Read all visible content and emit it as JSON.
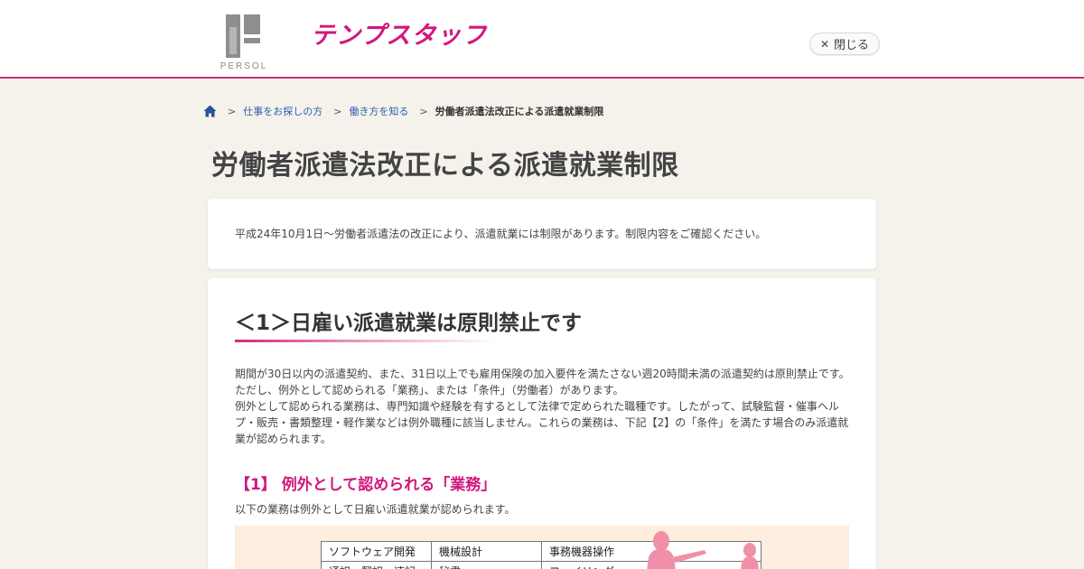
{
  "header": {
    "persol_text": "PERSOL",
    "brand_name": "テンプスタッフ",
    "close_label": "閉じる",
    "close_icon_glyph": "✕",
    "brand_color": "#d2177d"
  },
  "breadcrumb": {
    "home_icon": "home-icon",
    "separator": ">",
    "items": [
      {
        "label": "仕事をお探しの方"
      },
      {
        "label": "働き方を知る"
      },
      {
        "label": "労働者派遣法改正による派遣就業制限"
      }
    ]
  },
  "page": {
    "title": "労働者派遣法改正による派遣就業制限",
    "intro": "平成24年10月1日～労働者派遣法の改正により、派遣就業には制限があります。制限内容をご確認ください。"
  },
  "section1": {
    "heading": "＜1＞日雇い派遣就業は原則禁止です",
    "paragraphs": [
      "期間が30日以内の派遣契約、また、31日以上でも雇用保険の加入要件を満たさない週20時間未満の派遣契約は原則禁止です。",
      "ただし、例外として認められる「業務」、または「条件」（労働者）があります。",
      "例外として認められる業務は、専門知識や経験を有するとして法律で定められた職種です。したがって、試験監督・催事ヘルプ・販売・書類整理・軽作業などは例外職種に該当しません。これらの業務は、下記【2】の「条件」を満たす場合のみ派遣就業が認められます。"
    ],
    "sub_heading": "【1】 例外として認められる「業務」",
    "sub_text": "以下の業務は例外として日雇い派遣就業が認められます。",
    "duties_table": [
      [
        "ソフトウェア開発",
        "機械設計",
        "事務機器操作"
      ],
      [
        "通訳・翻訳・速記",
        "秘書",
        "ファイリング"
      ]
    ]
  }
}
